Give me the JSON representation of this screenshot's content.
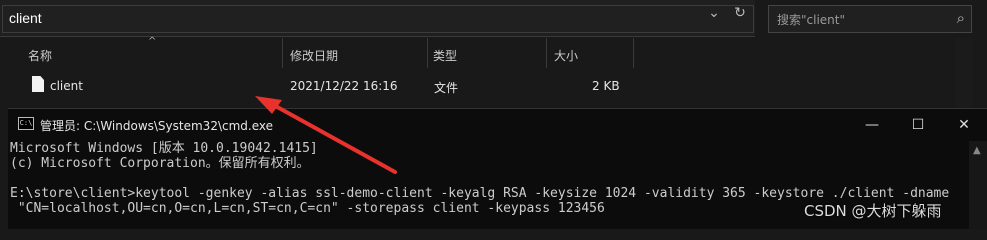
{
  "explorer": {
    "address": "client",
    "search_placeholder": "搜索\"client\"",
    "columns": {
      "name": "名称",
      "modified": "修改日期",
      "type": "类型",
      "size": "大小"
    },
    "files": [
      {
        "name": "client",
        "modified": "2021/12/22 16:16",
        "type": "文件",
        "size": "2 KB"
      }
    ]
  },
  "cmd": {
    "title": "管理员: C:\\Windows\\System32\\cmd.exe",
    "logo_text": "C:\\",
    "lines": [
      "Microsoft Windows [版本 10.0.19042.1415]",
      "(c) Microsoft Corporation。保留所有权利。",
      "",
      "E:\\store\\client>keytool -genkey -alias ssl-demo-client -keyalg RSA -keysize 1024 -validity 365 -keystore ./client -dname",
      " \"CN=localhost,OU=cn,O=cn,L=cn,ST=cn,C=cn\" -storepass client -keypass 123456"
    ]
  },
  "annotation": {
    "arrow_color": "#e8322b"
  },
  "watermark": "CSDN @大树下躲雨"
}
